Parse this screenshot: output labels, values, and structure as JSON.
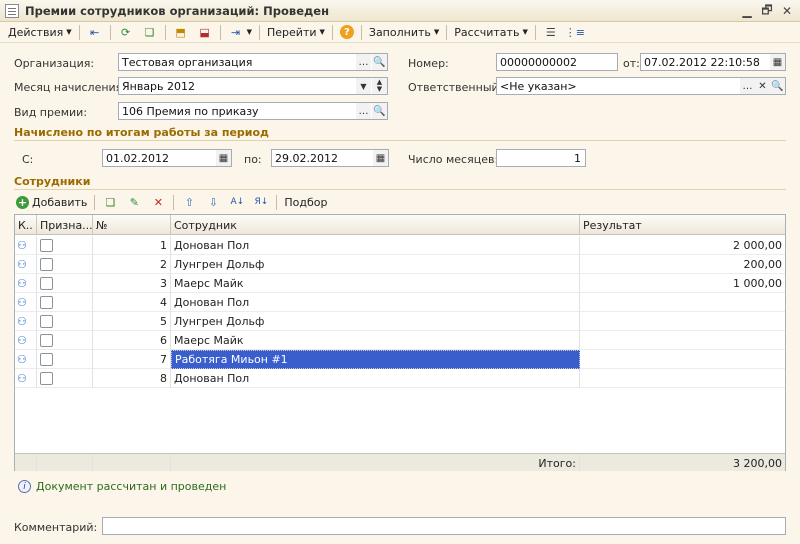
{
  "window": {
    "title": "Премии сотрудников организаций: Проведен"
  },
  "toolbar": {
    "actions": "Действия",
    "goto": "Перейти",
    "fill": "Заполнить",
    "calculate": "Рассчитать"
  },
  "form": {
    "org_label": "Организация:",
    "org_value": "Тестовая организация",
    "month_label": "Месяц начисления:",
    "month_value": "Январь 2012",
    "bonus_type_label": "Вид премии:",
    "bonus_type_value": "106 Премия по приказу",
    "number_label": "Номер:",
    "number_value": "00000000002",
    "date_label": "от:",
    "date_value": "07.02.2012 22:10:58",
    "responsible_label": "Ответственный:",
    "responsible_value": "<Не указан>"
  },
  "period": {
    "section_title": "Начислено по итогам работы за период",
    "from_label": "С:",
    "from_value": "01.02.2012",
    "to_label": "по:",
    "to_value": "29.02.2012",
    "months_label": "Число месяцев:",
    "months_value": "1"
  },
  "employees": {
    "section_title": "Сотрудники",
    "add_label": "Добавить",
    "selection_label": "Подбор",
    "columns": {
      "k": "К..",
      "flag": "Призна...",
      "num": "№",
      "employee": "Сотрудник",
      "result": "Результат"
    },
    "rows": [
      {
        "num": "1",
        "employee": "Донован Пол",
        "result": "2 000,00"
      },
      {
        "num": "2",
        "employee": "Лунгрен Дольф",
        "result": "200,00"
      },
      {
        "num": "3",
        "employee": "Маерс Майк",
        "result": "1 000,00"
      },
      {
        "num": "4",
        "employee": "Донован Пол",
        "result": ""
      },
      {
        "num": "5",
        "employee": "Лунгрен Дольф",
        "result": ""
      },
      {
        "num": "6",
        "employee": "Маерс Майк",
        "result": ""
      },
      {
        "num": "7",
        "employee": "Работяга Миьон #1",
        "result": ""
      },
      {
        "num": "8",
        "employee": "Донован Пол",
        "result": ""
      }
    ],
    "total_label": "Итого:",
    "total_value": "3 200,00"
  },
  "status": {
    "message": "Документ рассчитан и проведен"
  },
  "comment": {
    "label": "Комментарий:",
    "value": ""
  }
}
